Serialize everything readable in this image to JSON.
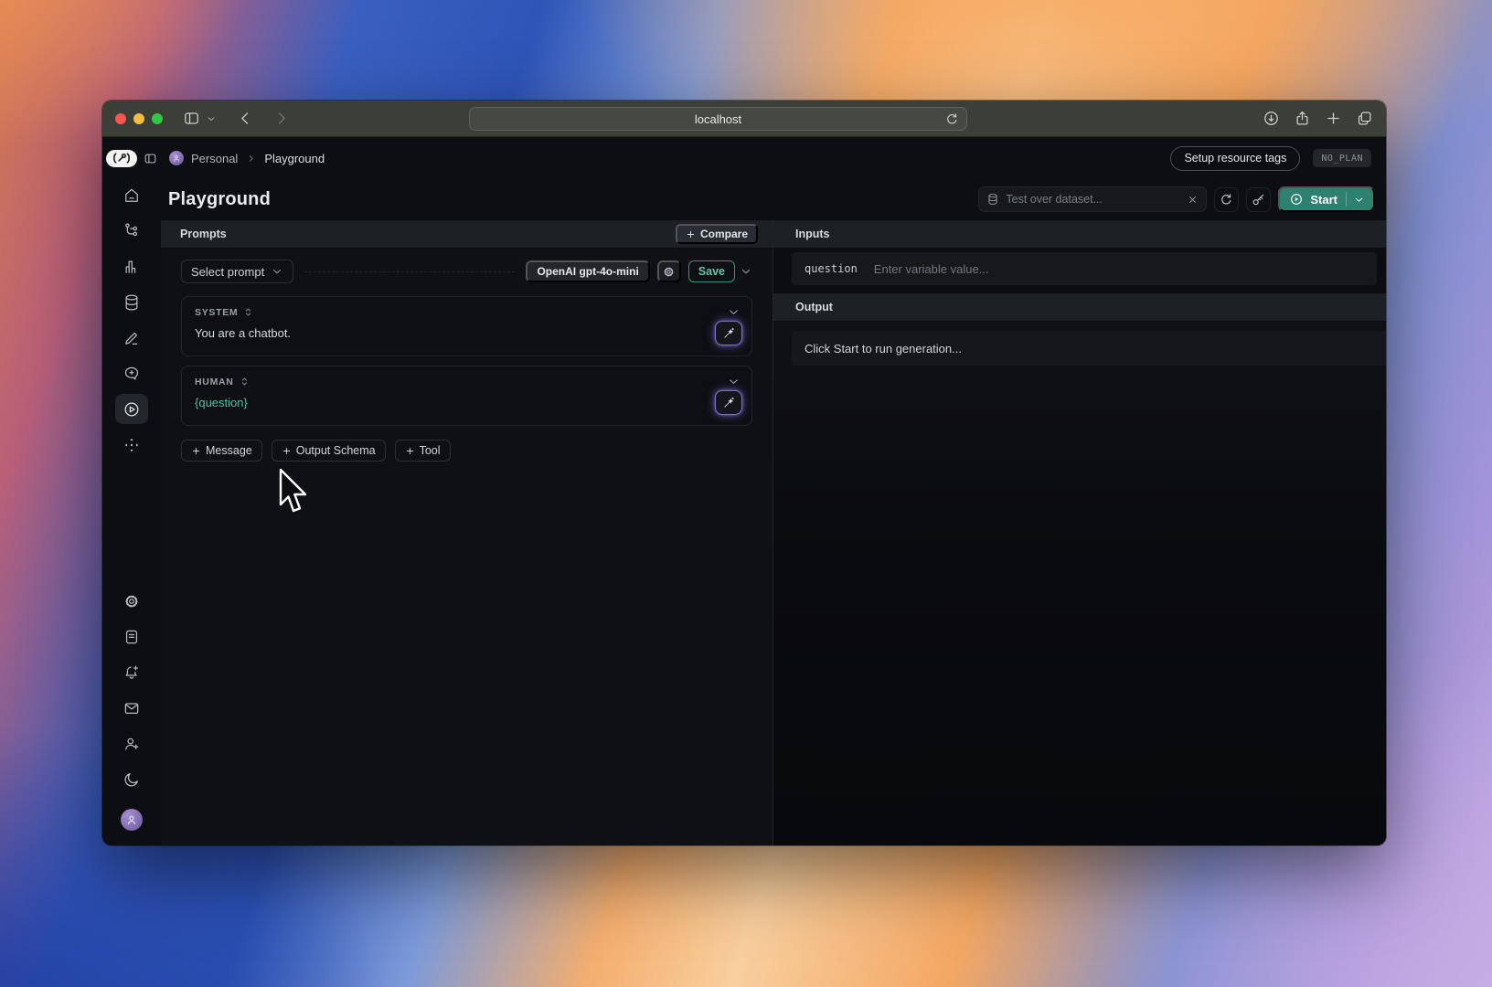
{
  "browser": {
    "url": "localhost"
  },
  "topbar": {
    "breadcrumb_workspace": "Personal",
    "breadcrumb_page": "Playground",
    "setup_resource_tags_label": "Setup resource tags",
    "plan_badge": "NO_PLAN"
  },
  "header": {
    "title": "Playground",
    "dataset_input_placeholder": "Test over dataset...",
    "start_label": "Start"
  },
  "prompts": {
    "panel_title": "Prompts",
    "compare_label": "Compare",
    "select_prompt_label": "Select prompt",
    "model_badge": "OpenAI gpt-4o-mini",
    "save_label": "Save",
    "messages": [
      {
        "role": "SYSTEM",
        "content": "You are a chatbot."
      },
      {
        "role": "HUMAN",
        "content": "{question}"
      }
    ],
    "add_buttons": [
      "Message",
      "Output Schema",
      "Tool"
    ]
  },
  "inputs": {
    "panel_title": "Inputs",
    "variables": [
      {
        "name": "question",
        "placeholder": "Enter variable value..."
      }
    ]
  },
  "output": {
    "panel_title": "Output",
    "empty_message": "Click Start to run generation..."
  },
  "icons": {
    "start_play": "▶",
    "dropdown_caret": "▾",
    "close": "×",
    "refresh": "⟳",
    "magic_wand": "✦",
    "settings_gear": "⚙",
    "database": "⛁"
  },
  "colors": {
    "accent_teal": "#2e8170",
    "save_teal": "#63c2a8",
    "variable_teal": "#4fbfa3",
    "wand_purple": "#7c6fd4",
    "traffic_red": "#f5564e",
    "traffic_yellow": "#f6bd40",
    "traffic_green": "#33c748"
  }
}
